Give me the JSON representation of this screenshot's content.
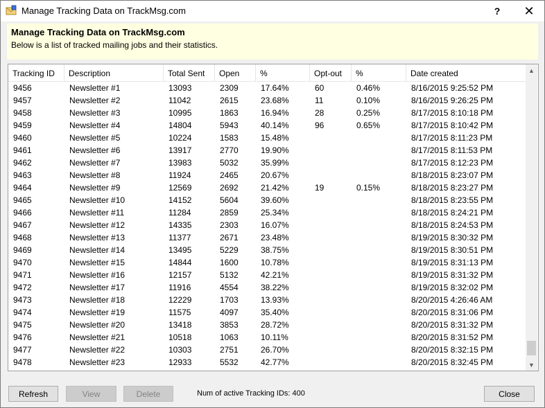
{
  "window": {
    "title": "Manage Tracking Data on TrackMsg.com",
    "help_label": "?",
    "close_label": "✕"
  },
  "header": {
    "title": "Manage Tracking Data on TrackMsg.com",
    "description": "Below is a list of tracked mailing jobs and their statistics."
  },
  "table": {
    "columns": [
      "Tracking ID",
      "Description",
      "Total Sent",
      "Open",
      "%",
      "Opt-out",
      "%",
      "Date created"
    ],
    "rows": [
      [
        "9456",
        "Newsletter #1",
        "13093",
        "2309",
        "17.64%",
        "60",
        "0.46%",
        "8/16/2015 9:25:52 PM"
      ],
      [
        "9457",
        "Newsletter #2",
        "11042",
        "2615",
        "23.68%",
        "11",
        "0.10%",
        "8/16/2015 9:26:25 PM"
      ],
      [
        "9458",
        "Newsletter #3",
        "10995",
        "1863",
        "16.94%",
        "28",
        "0.25%",
        "8/17/2015 8:10:18 PM"
      ],
      [
        "9459",
        "Newsletter #4",
        "14804",
        "5943",
        "40.14%",
        "96",
        "0.65%",
        "8/17/2015 8:10:42 PM"
      ],
      [
        "9460",
        "Newsletter #5",
        "10224",
        "1583",
        "15.48%",
        "",
        "",
        "8/17/2015 8:11:23 PM"
      ],
      [
        "9461",
        "Newsletter #6",
        "13917",
        "2770",
        "19.90%",
        "",
        "",
        "8/17/2015 8:11:53 PM"
      ],
      [
        "9462",
        "Newsletter #7",
        "13983",
        "5032",
        "35.99%",
        "",
        "",
        "8/17/2015 8:12:23 PM"
      ],
      [
        "9463",
        "Newsletter #8",
        "11924",
        "2465",
        "20.67%",
        "",
        "",
        "8/18/2015 8:23:07 PM"
      ],
      [
        "9464",
        "Newsletter #9",
        "12569",
        "2692",
        "21.42%",
        "19",
        "0.15%",
        "8/18/2015 8:23:27 PM"
      ],
      [
        "9465",
        "Newsletter #10",
        "14152",
        "5604",
        "39.60%",
        "",
        "",
        "8/18/2015 8:23:55 PM"
      ],
      [
        "9466",
        "Newsletter #11",
        "11284",
        "2859",
        "25.34%",
        "",
        "",
        "8/18/2015 8:24:21 PM"
      ],
      [
        "9467",
        "Newsletter #12",
        "14335",
        "2303",
        "16.07%",
        "",
        "",
        "8/18/2015 8:24:53 PM"
      ],
      [
        "9468",
        "Newsletter #13",
        "11377",
        "2671",
        "23.48%",
        "",
        "",
        "8/19/2015 8:30:32 PM"
      ],
      [
        "9469",
        "Newsletter #14",
        "13495",
        "5229",
        "38.75%",
        "",
        "",
        "8/19/2015 8:30:51 PM"
      ],
      [
        "9470",
        "Newsletter #15",
        "14844",
        "1600",
        "10.78%",
        "",
        "",
        "8/19/2015 8:31:13 PM"
      ],
      [
        "9471",
        "Newsletter #16",
        "12157",
        "5132",
        "42.21%",
        "",
        "",
        "8/19/2015 8:31:32 PM"
      ],
      [
        "9472",
        "Newsletter #17",
        "11916",
        "4554",
        "38.22%",
        "",
        "",
        "8/19/2015 8:32:02 PM"
      ],
      [
        "9473",
        "Newsletter #18",
        "12229",
        "1703",
        "13.93%",
        "",
        "",
        "8/20/2015 4:26:46 AM"
      ],
      [
        "9474",
        "Newsletter #19",
        "11575",
        "4097",
        "35.40%",
        "",
        "",
        "8/20/2015 8:31:06 PM"
      ],
      [
        "9475",
        "Newsletter #20",
        "13418",
        "3853",
        "28.72%",
        "",
        "",
        "8/20/2015 8:31:32 PM"
      ],
      [
        "9476",
        "Newsletter #21",
        "10518",
        "1063",
        "10.11%",
        "",
        "",
        "8/20/2015 8:31:52 PM"
      ],
      [
        "9477",
        "Newsletter #22",
        "10303",
        "2751",
        "26.70%",
        "",
        "",
        "8/20/2015 8:32:15 PM"
      ],
      [
        "9478",
        "Newsletter #23",
        "12933",
        "5532",
        "42.77%",
        "",
        "",
        "8/20/2015 8:32:45 PM"
      ]
    ]
  },
  "footer": {
    "refresh_label": "Refresh",
    "view_label": "View",
    "delete_label": "Delete",
    "status_text": "Num of active Tracking IDs: 400",
    "close_label": "Close"
  }
}
